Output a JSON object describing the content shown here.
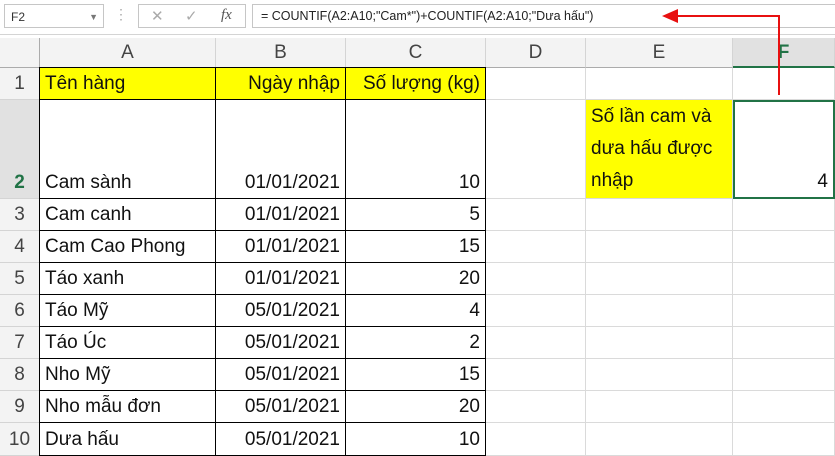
{
  "name_box": "F2",
  "formula": "= COUNTIF(A2:A10;\"Cam*\")+COUNTIF(A2:A10;\"Dưa hấu\")",
  "columns": [
    "A",
    "B",
    "C",
    "D",
    "E",
    "F"
  ],
  "rows": [
    "1",
    "2",
    "3",
    "4",
    "5",
    "6",
    "7",
    "8",
    "9",
    "10"
  ],
  "headers": [
    "Tên hàng",
    "Ngày nhập",
    "Số lượng (kg)"
  ],
  "data": [
    [
      "Cam sành",
      "01/01/2021",
      "10"
    ],
    [
      "Cam canh",
      "01/01/2021",
      "5"
    ],
    [
      "Cam Cao Phong",
      "01/01/2021",
      "15"
    ],
    [
      "Táo xanh",
      "01/01/2021",
      "20"
    ],
    [
      "Táo Mỹ",
      "05/01/2021",
      "4"
    ],
    [
      "Táo Úc",
      "05/01/2021",
      "2"
    ],
    [
      "Nho Mỹ",
      "05/01/2021",
      "15"
    ],
    [
      "Nho mẫu đơn",
      "05/01/2021",
      "20"
    ],
    [
      "Dưa hấu",
      "05/01/2021",
      "10"
    ]
  ],
  "label_e2": "Số lần cam và dưa hấu được nhập",
  "result_f2": "4",
  "colors": {
    "highlight": "#ffff00",
    "arrow": "#e81010",
    "selection": "#217346"
  }
}
